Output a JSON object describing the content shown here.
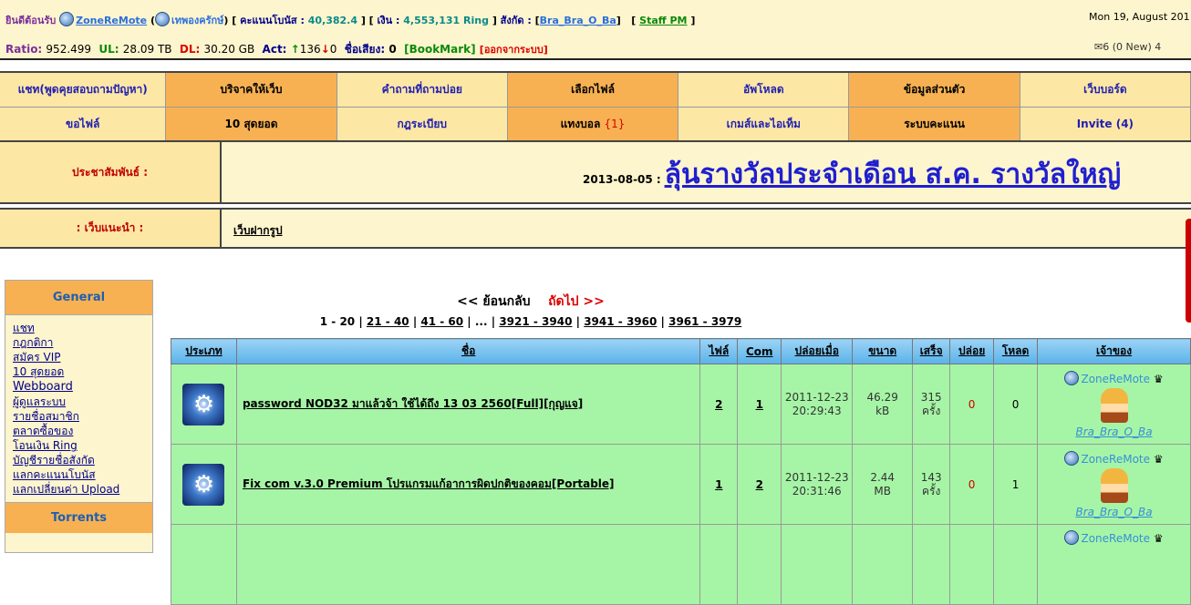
{
  "topbar": {
    "welcome": "ยินดีต้อนรับ",
    "site": "ZoneReMote",
    "rank": "เทพองครักษ์",
    "bonus_label": "คะแนนโบนัส :",
    "bonus_value": "40,382.4",
    "money_label": "เงิน :",
    "money_value": "4,553,131 Ring",
    "group_label": "สังกัด :",
    "group_value": "Bra_Bra_O_Ba",
    "staff_pm": "Staff PM",
    "date": "Mon 19, August 201",
    "ratio_label": "Ratio:",
    "ratio_value": "952.499",
    "ul_label": "UL:",
    "ul_value": "28.09 TB",
    "dl_label": "DL:",
    "dl_value": "30.20 GB",
    "act_label": "Act:",
    "act_up": "136",
    "act_down": "0",
    "fame_label": "ชื่อเสียง:",
    "fame_value": "0",
    "bookmark": "[BookMark]",
    "logout": "[ออกจากระบบ]",
    "pm_status": "6 (0 New) 4"
  },
  "nav": {
    "row1": [
      "แชท(พูดคุยสอบถามปัญหา)",
      "บริจาคให้เว็บ",
      "คำถามที่ถามบ่อย",
      "เลือกไฟล์",
      "อัพโหลด",
      "ข้อมูลส่วนตัว",
      "เว็บบอร์ด"
    ],
    "row2": [
      "ขอไฟล์",
      "10 สุดยอด",
      "กฎระเบียบ",
      "แทงบอล",
      "เกมส์และไอเท็ม",
      "ระบบคะแนน",
      "Invite (4)"
    ],
    "betting_count": "{1}"
  },
  "news": {
    "label": "ประชาสัมพันธ์ :",
    "date": "2013-08-05 :",
    "title": "ลุ้นรางวัลประจำเดือน ส.ค. รางวัลใหญ่"
  },
  "recommend": {
    "label": ": เว็บแนะนำ :",
    "link": "เว็บฝากรูป"
  },
  "sidebar": {
    "general_title": "General",
    "items": [
      "แชท",
      "กฎกติกา",
      "สมัคร VIP",
      "10 สุดยอด",
      "Webboard",
      "ผู้ดูแลระบบ",
      "รายชื่อสมาชิก",
      "ตลาดซื้อของ",
      "โอนเงิน Ring",
      "บัญชีรายชื่อสังกัด",
      "แลกคะแนนโบนัส",
      "แลกเปลี่ยนค่า Upload"
    ],
    "torrents_title": "Torrents"
  },
  "pager": {
    "back": "<< ย้อนกลับ",
    "next": "ถัดไป >>",
    "current": "1 - 20",
    "links": [
      "21 - 40",
      "41 - 60",
      "...",
      "3921 - 3940",
      "3941 - 3960",
      "3961 - 3979"
    ]
  },
  "table": {
    "headers": [
      "ประเภท",
      "ชื่อ",
      "ไฟล์",
      "Com",
      "ปล่อยเมื่อ",
      "ขนาด",
      "เสร็จ",
      "ปล่อย",
      "โหลด",
      "เจ้าของ"
    ],
    "rows": [
      {
        "name": "password NOD32 มาแล้วจ้า ใช้ได้ถึง 13 03 2560[Full][กุญแจ]",
        "files": "2",
        "com": "1",
        "date": "2011-12-23",
        "time": "20:29:43",
        "size_num": "46.29",
        "size_unit": "kB",
        "done_num": "315",
        "done_unit": "ครั้ง",
        "seed": "0",
        "leech": "0",
        "owner_site": "ZoneReMote",
        "owner_name": "Bra_Bra_O_Ba"
      },
      {
        "name": "Fix com v.3.0 Premium โปรแกรมแก้อาการผิดปกติของคอม[Portable]",
        "files": "1",
        "com": "2",
        "date": "2011-12-23",
        "time": "20:31:46",
        "size_num": "2.44",
        "size_unit": "MB",
        "done_num": "143",
        "done_unit": "ครั้ง",
        "seed": "0",
        "leech": "1",
        "owner_site": "ZoneReMote",
        "owner_name": "Bra_Bra_O_Ba"
      },
      {
        "owner_site": "ZoneReMote"
      }
    ]
  },
  "colors": {
    "topbar_bg": "#fdf5cd",
    "nav_light": "#fde7a5",
    "nav_dark": "#f7b153",
    "row_bg": "#a6f5a6",
    "header_bg": "#5ab2ea"
  }
}
